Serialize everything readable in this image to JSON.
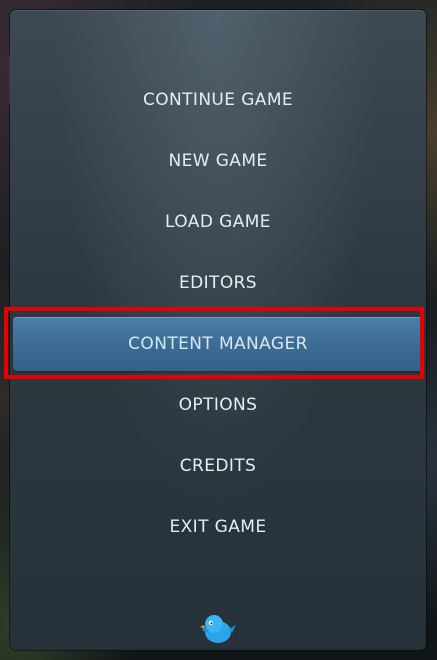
{
  "menu": {
    "items": [
      {
        "label": "CONTINUE GAME"
      },
      {
        "label": "NEW GAME"
      },
      {
        "label": "LOAD GAME"
      },
      {
        "label": "EDITORS"
      },
      {
        "label": "CONTENT MANAGER"
      },
      {
        "label": "OPTIONS"
      },
      {
        "label": "CREDITS"
      },
      {
        "label": "EXIT GAME"
      }
    ],
    "selected_index": 4
  },
  "colors": {
    "panel": "#2d3941",
    "selected": "#3b6b93",
    "highlight_outline": "#e60000",
    "logo": "#2aa6e8"
  },
  "footer": {
    "logo_icon": "bird-logo-icon"
  }
}
